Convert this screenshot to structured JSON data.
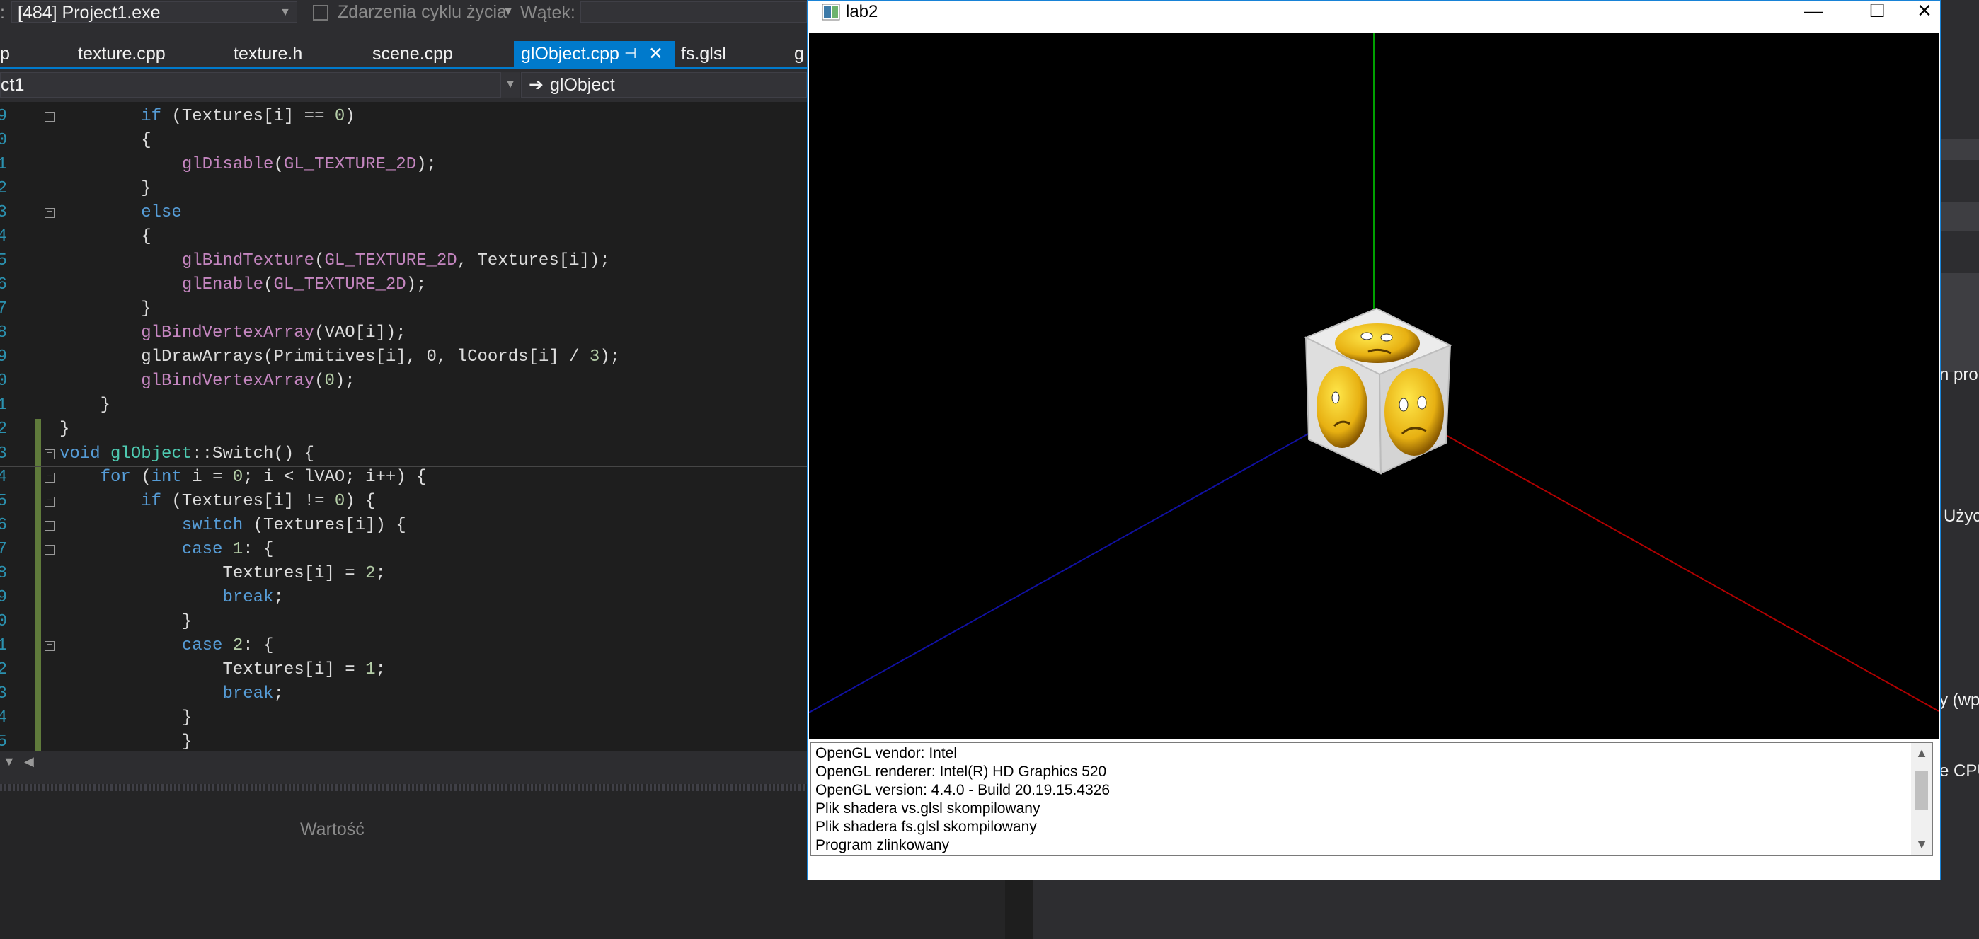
{
  "toolbar": {
    "process_label_prefix": ":",
    "process_value": "[484] Project1.exe",
    "lifecycle_events": "Zdarzenia cyklu życia",
    "thread_label": "Wątek:"
  },
  "tabs": [
    {
      "label": "p",
      "active": false
    },
    {
      "label": "texture.cpp",
      "active": false
    },
    {
      "label": "texture.h",
      "active": false
    },
    {
      "label": "scene.cpp",
      "active": false
    },
    {
      "label": "glObject.cpp",
      "active": true
    },
    {
      "label": "fs.glsl",
      "active": false
    },
    {
      "label": "g",
      "active": false
    }
  ],
  "navbar": {
    "project_scope": "ct1",
    "member": "glObject"
  },
  "editor": {
    "line_numbers": [
      "9",
      "0",
      "1",
      "2",
      "3",
      "4",
      "5",
      "6",
      "7",
      "8",
      "9",
      "0",
      "1",
      "2",
      "3",
      "4",
      "5",
      "6",
      "7",
      "8",
      "9",
      "0",
      "1",
      "2",
      "3",
      "4",
      "5"
    ],
    "lines": [
      "        if (Textures[i] == 0)",
      "        {",
      "            glDisable(GL_TEXTURE_2D);",
      "        }",
      "        else",
      "        {",
      "            glBindTexture(GL_TEXTURE_2D, Textures[i]);",
      "            glEnable(GL_TEXTURE_2D);",
      "        }",
      "        glBindVertexArray(VAO[i]);",
      "        glDrawArrays(Primitives[i], 0, lCoords[i] / 3);",
      "        glBindVertexArray(0);",
      "    }",
      "}",
      "void glObject::Switch() {",
      "    for (int i = 0; i < lVAO; i++) {",
      "        if (Textures[i] != 0) {",
      "            switch (Textures[i]) {",
      "            case 1: {",
      "                Textures[i] = 2;",
      "                break;",
      "            }",
      "            case 2: {",
      "                Textures[i] = 1;",
      "                break;",
      "            }",
      "            }"
    ]
  },
  "bottom_panel": {
    "column_header": "Wartość"
  },
  "right_panel": {
    "text_1": "n pro",
    "text_2": "Użyc",
    "text_3": "y (wp",
    "text_4": "e CPU"
  },
  "gl_window": {
    "title": "lab2",
    "minimize": "—",
    "maximize": "☐",
    "close": "✕"
  },
  "console": {
    "lines": [
      "OpenGL vendor: Intel",
      "OpenGL renderer: Intel(R) HD Graphics 520",
      "OpenGL version: 4.4.0 - Build 20.19.15.4326",
      "Plik shadera vs.glsl skompilowany",
      "Plik shadera fs.glsl skompilowany",
      "Program zlinkowany"
    ]
  },
  "colors": {
    "accent": "#007acc",
    "editor_bg": "#1e1e1e",
    "axis_x": "#b00000",
    "axis_y": "#00a000",
    "axis_z": "#1010a0"
  }
}
